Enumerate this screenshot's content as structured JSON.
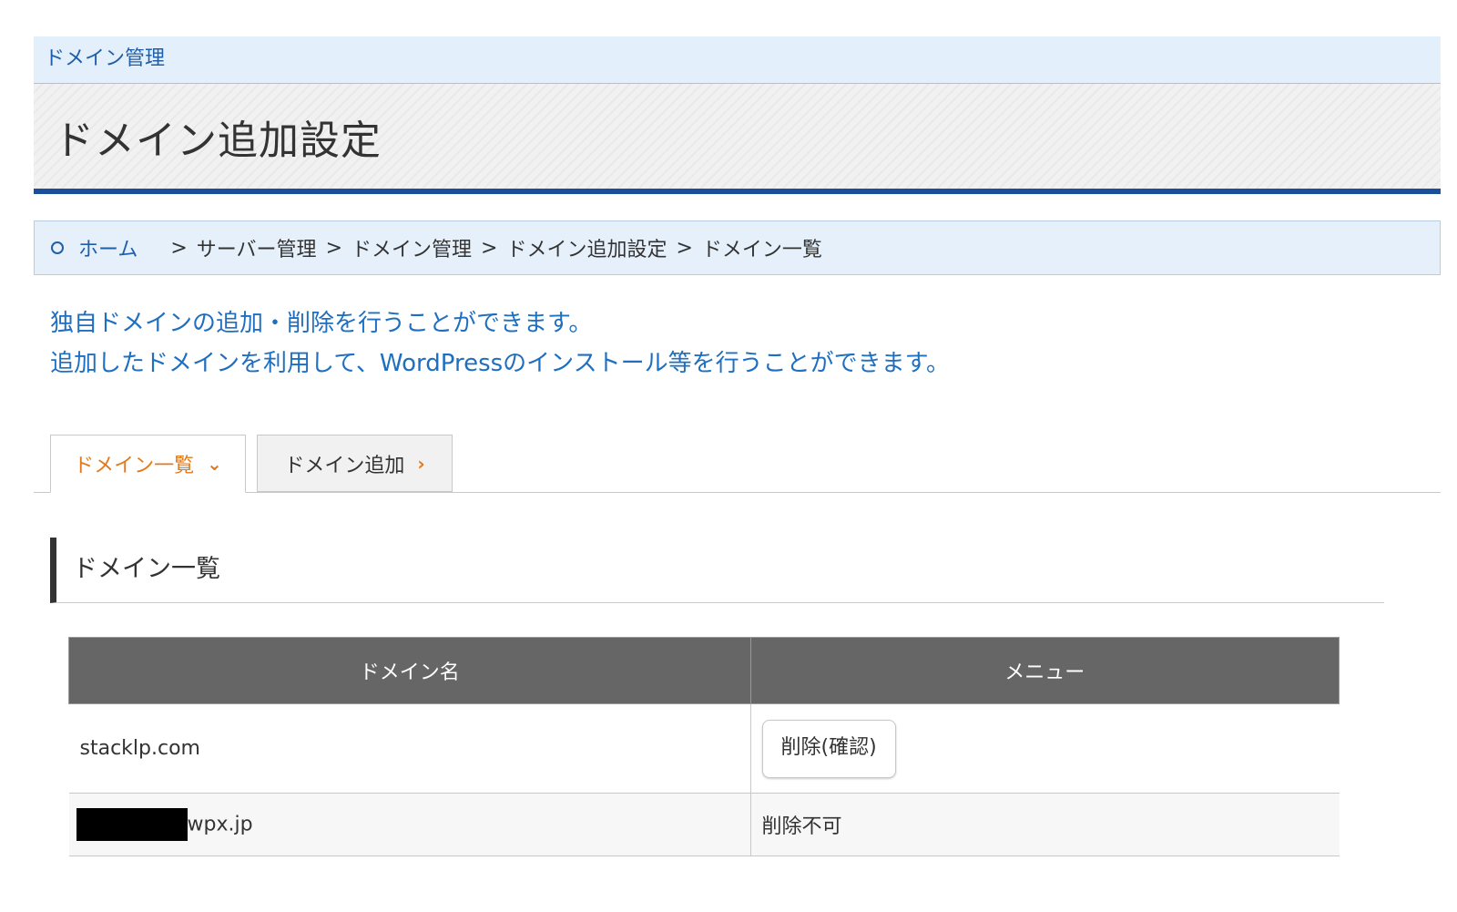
{
  "header": {
    "section_label": "ドメイン管理",
    "page_title": "ドメイン追加設定"
  },
  "breadcrumb": {
    "home": "ホーム",
    "items": [
      "サーバー管理",
      "ドメイン管理",
      "ドメイン追加設定",
      "ドメイン一覧"
    ],
    "separator": ">"
  },
  "intro": {
    "line1": "独自ドメインの追加・削除を行うことができます。",
    "line2": "追加したドメインを利用して、WordPressのインストール等を行うことができます。"
  },
  "tabs": [
    {
      "label": "ドメイン一覧",
      "active": true,
      "icon": "chevron-down-icon"
    },
    {
      "label": "ドメイン追加",
      "active": false,
      "icon": "chevron-right-icon"
    }
  ],
  "section": {
    "heading": "ドメイン一覧"
  },
  "table": {
    "headers": [
      "ドメイン名",
      "メニュー"
    ],
    "rows": [
      {
        "domain": "stacklp.com",
        "action": "削除(確認)"
      },
      {
        "domain": "wpx.jp",
        "action": "削除不可"
      }
    ]
  },
  "colors": {
    "primary_blue": "#1b4f9c",
    "link_blue": "#1f5fa8",
    "intro_blue": "#1f6fc0",
    "accent_orange": "#e3791b",
    "table_header_bg": "#666666"
  }
}
